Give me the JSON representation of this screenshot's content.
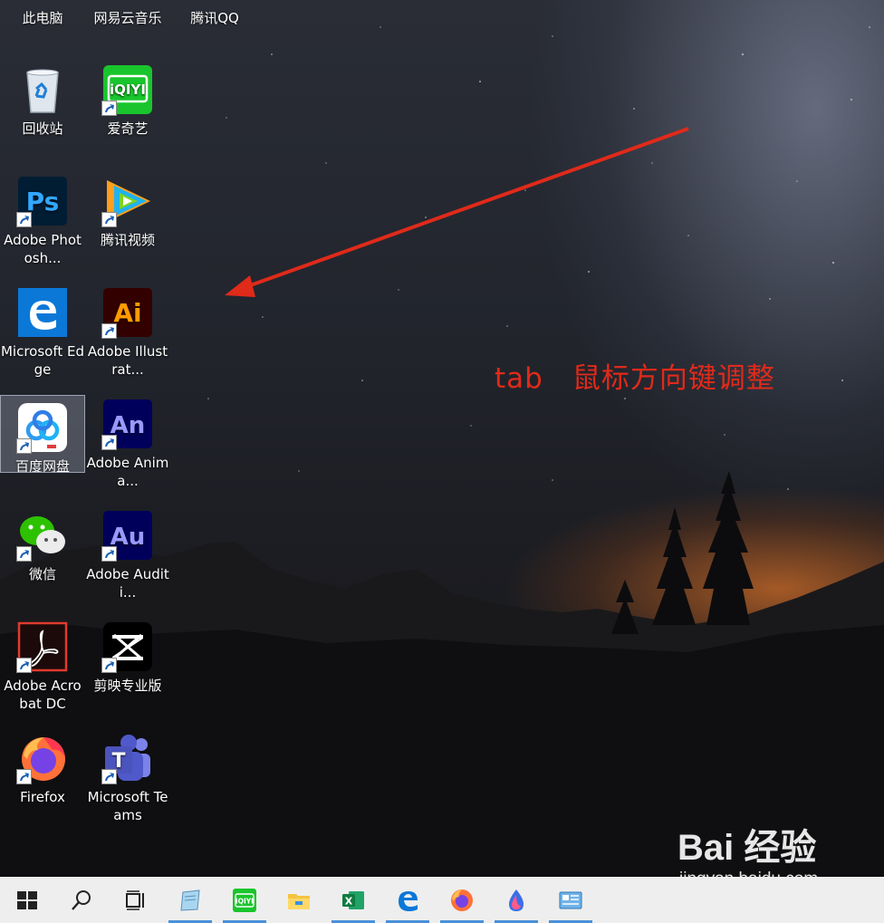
{
  "desktop": {
    "top_partial": [
      {
        "label": "此电脑"
      },
      {
        "label": "网易云音乐"
      },
      {
        "label": "腾讯QQ"
      }
    ],
    "icons": [
      {
        "label": "回收站",
        "icon": "recycle-bin-icon"
      },
      {
        "label": "爱奇艺",
        "icon": "iqiyi-icon"
      },
      {
        "label": "Adobe Photosh...",
        "icon": "photoshop-icon"
      },
      {
        "label": "腾讯视频",
        "icon": "tencent-video-icon"
      },
      {
        "label": "Microsoft Edge",
        "icon": "edge-icon"
      },
      {
        "label": "Adobe Illustrat...",
        "icon": "illustrator-icon"
      },
      {
        "label": "百度网盘",
        "icon": "baidu-netdisk-icon"
      },
      {
        "label": "Adobe Anima...",
        "icon": "animate-icon"
      },
      {
        "label": "微信",
        "icon": "wechat-icon"
      },
      {
        "label": "Adobe Auditi...",
        "icon": "audition-icon"
      },
      {
        "label": "Adobe Acrobat DC",
        "icon": "acrobat-icon"
      },
      {
        "label": "剪映专业版",
        "icon": "jianying-icon"
      },
      {
        "label": "Firefox",
        "icon": "firefox-icon"
      },
      {
        "label": "Microsoft Teams",
        "icon": "teams-icon"
      }
    ],
    "tile_text": {
      "iqiyi": "iQIYI",
      "ps": "Ps",
      "ai": "Ai",
      "an": "An",
      "au": "Au",
      "teams": "T"
    }
  },
  "annotation": {
    "text": "tab　鼠标方向键调整",
    "color": "#e02a1a"
  },
  "taskbar": {
    "start": "windows-start-icon",
    "search": "search-icon",
    "task_view": "task-view-icon",
    "tile_iqiyi": "iQIYI",
    "excel_letter": "X",
    "apps": [
      "notepad-icon",
      "iqiyi-icon",
      "file-explorer-icon",
      "excel-icon",
      "edge-icon",
      "firefox-icon",
      "drop-app-icon",
      "control-panel-icon"
    ]
  },
  "watermark": {
    "logo": "Bai 经验",
    "url": "jingyan.baidu.com"
  }
}
